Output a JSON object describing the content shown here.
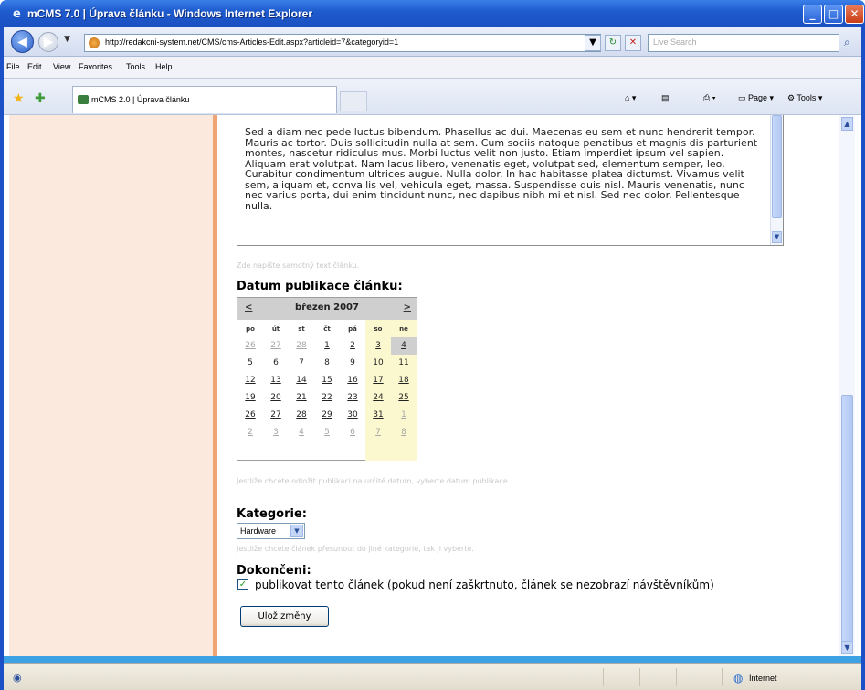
{
  "window": {
    "title": "mCMS 7.0 | Úprava článku - Windows Internet Explorer",
    "minimize": "_",
    "maximize": "□",
    "close": "✕"
  },
  "address": {
    "url": "http://redakcni-system.net/CMS/cms-Articles-Edit.aspx?articleid=7&categoryid=1",
    "search_placeholder": "Live Search"
  },
  "menu": [
    "File",
    "Edit",
    "View",
    "Favorites",
    "Tools",
    "Help"
  ],
  "tab": {
    "label": "mCMS 2.0 | Úprava článku"
  },
  "commandbar": {
    "page": "Page",
    "tools": "Tools"
  },
  "article": {
    "body": "Sed a diam nec pede luctus bibendum. Phasellus ac dui. Maecenas eu sem et nunc hendrerit tempor. Mauris ac tortor. Duis sollicitudin nulla at sem. Cum sociis natoque penatibus et magnis dis parturient montes, nascetur ridiculus mus. Morbi luctus velit non justo. Etiam imperdiet ipsum vel sapien. Aliquam erat volutpat. Nam lacus libero, venenatis eget, volutpat sed, elementum semper, leo. Curabitur condimentum ultrices augue. Nulla dolor. In hac habitasse platea dictumst. Vivamus velit sem, aliquam et, convallis vel, vehicula eget, massa. Suspendisse quis nisl. Mauris venenatis, nunc nec varius porta, dui enim tincidunt nunc, nec dapibus nibh mi et nisl. Sed nec dolor. Pellentesque nulla.",
    "body_hint": "Zde napište samotný text článku."
  },
  "publish_date": {
    "heading": "Datum publikace článku:",
    "calendar": {
      "prev": "<",
      "next": ">",
      "month": "březen 2007",
      "day_names": [
        "po",
        "út",
        "st",
        "čt",
        "pá",
        "so",
        "ne"
      ],
      "weeks": [
        [
          "26",
          "27",
          "28",
          "1",
          "2",
          "3",
          "4"
        ],
        [
          "5",
          "6",
          "7",
          "8",
          "9",
          "10",
          "11"
        ],
        [
          "12",
          "13",
          "14",
          "15",
          "16",
          "17",
          "18"
        ],
        [
          "19",
          "20",
          "21",
          "22",
          "23",
          "24",
          "25"
        ],
        [
          "26",
          "27",
          "28",
          "29",
          "30",
          "31",
          "1"
        ],
        [
          "2",
          "3",
          "4",
          "5",
          "6",
          "7",
          "8"
        ]
      ],
      "selected": "4"
    },
    "hint": "Jestliže chcete odložit publikaci na určité datum, vyberte datum publikace."
  },
  "category": {
    "heading": "Kategorie:",
    "selected": "Hardware",
    "hint": "Jestliže chcete článek přesunout do jiné kategorie, tak ji vyberte."
  },
  "completion": {
    "heading": "Dokončeni:",
    "checkbox_label": "publikovat tento článek (pokud není zaškrtnuto, článek se nezobrazí návštěvníkům)",
    "checked": true
  },
  "save_button": "Ulož změny",
  "status": {
    "zone": "Internet"
  }
}
